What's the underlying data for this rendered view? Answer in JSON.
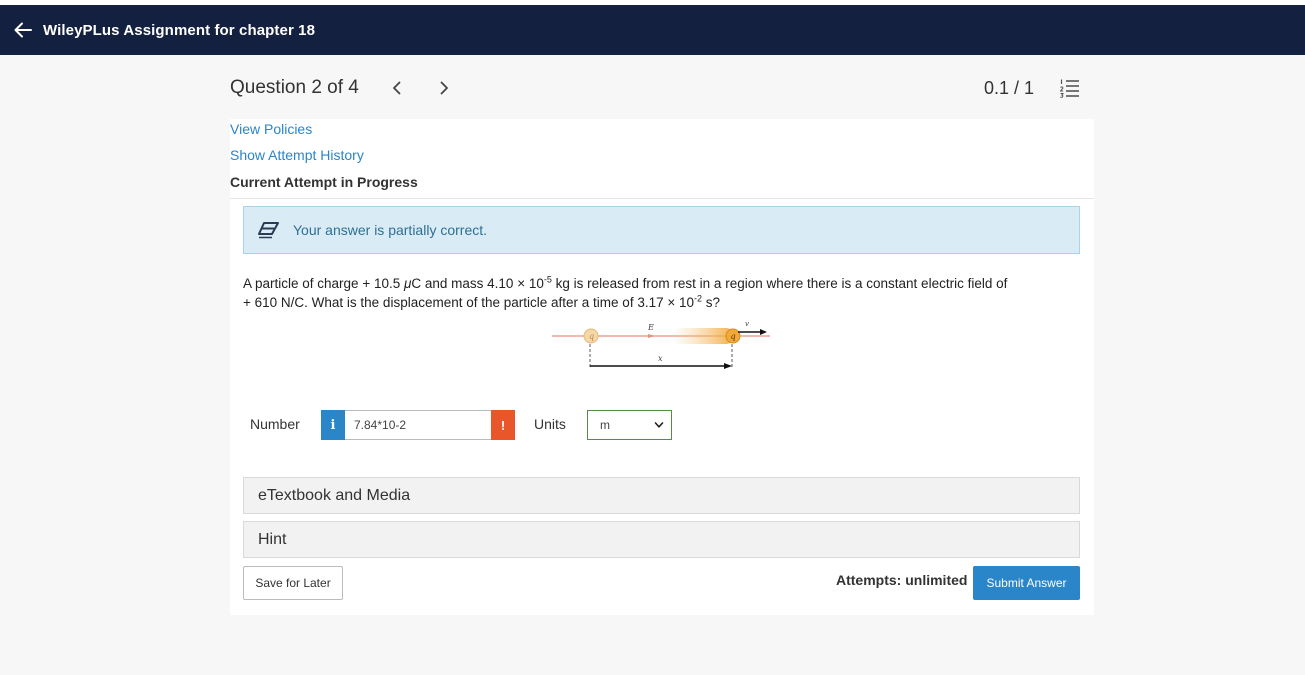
{
  "header": {
    "title": "WileyPLus Assignment for chapter 18"
  },
  "question_bar": {
    "title": "Question 2 of 4",
    "score": "0.1 / 1"
  },
  "links": {
    "view_policies": "View Policies",
    "show_history": "Show Attempt History"
  },
  "attempt_label": "Current Attempt in Progress",
  "alert": {
    "text": "Your answer is partially correct."
  },
  "question": {
    "part1": "A particle of charge + 10.5 ",
    "mu": "μ",
    "part2": "C and mass 4.10 × 10",
    "exp1": "-5",
    "part3": " kg is released from rest in a region where there is a constant electric field of",
    "part4": "+ 610 N/C. What is the displacement of the particle after a time of 3.17 × 10",
    "exp2": "-2",
    "part5": " s?"
  },
  "diagram": {
    "label_q": "q",
    "label_E": "E",
    "label_v": "v",
    "label_x": "x"
  },
  "answer": {
    "number_label": "Number",
    "info_symbol": "i",
    "value": "7.84*10-2",
    "warn_symbol": "!",
    "units_label": "Units",
    "unit_selected": "m"
  },
  "accordions": {
    "etextbook": "eTextbook and Media",
    "hint": "Hint"
  },
  "footer": {
    "save_label": "Save for Later",
    "attempts": "Attempts: unlimited",
    "submit_label": "Submit Answer"
  },
  "colors": {
    "header_bg": "#14203f",
    "link": "#2a86c8",
    "alert_bg": "#d9ecf5",
    "submit_bg": "#2a86c8",
    "warn": "#e8562a"
  },
  "icons": {
    "back": "arrow-left-icon",
    "prev": "chevron-left-icon",
    "next": "chevron-right-icon",
    "list": "numbered-list-icon",
    "alert": "eraser-icon",
    "select": "chevron-down-icon"
  }
}
